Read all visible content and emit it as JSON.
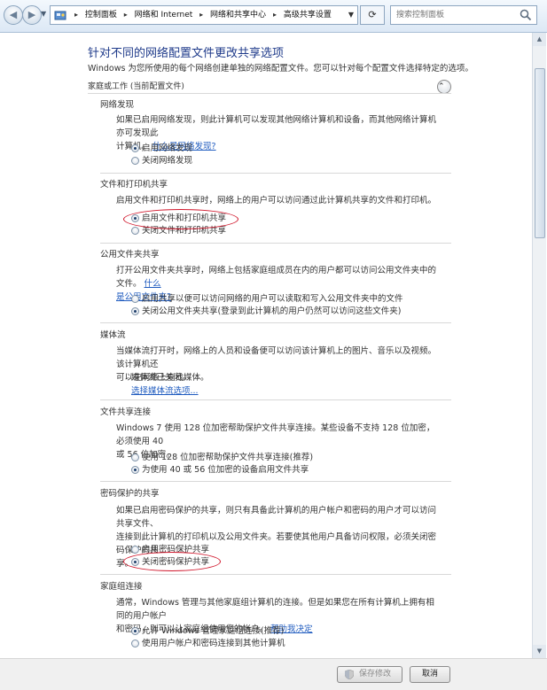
{
  "address_bar": {
    "breadcrumbs": [
      "控制面板",
      "网络和 Internet",
      "网络和共享中心",
      "高级共享设置"
    ],
    "refresh_icon": "refresh-icon"
  },
  "search": {
    "placeholder": "搜索控制面板"
  },
  "page": {
    "title": "针对不同的网络配置文件更改共享选项",
    "subtitle": "Windows 为您所使用的每个网络创建单独的网络配置文件。您可以针对每个配置文件选择特定的选项。",
    "profile_label": "家庭或工作 (当前配置文件)"
  },
  "sections": {
    "network_discovery": {
      "title": "网络发现",
      "desc_line1": "如果已启用网络发现，则此计算机可以发现其他网络计算机和设备，而其他网络计算机亦可发现此",
      "desc_line2": "计算机。",
      "link": "什么是网络发现?",
      "options": [
        "启用网络发现",
        "关闭网络发现"
      ],
      "selected": 0
    },
    "file_printer": {
      "title": "文件和打印机共享",
      "desc": "启用文件和打印机共享时，网络上的用户可以访问通过此计算机共享的文件和打印机。",
      "options": [
        "启用文件和打印机共享",
        "关闭文件和打印机共享"
      ],
      "selected": 0
    },
    "public_folder": {
      "title": "公用文件夹共享",
      "desc_line1": "打开公用文件夹共享时，网络上包括家庭组成员在内的用户都可以访问公用文件夹中的文件。",
      "link_part1": "什么",
      "link_part2": "是公用文件夹?",
      "options": [
        "启用共享以便可以访问网络的用户可以读取和写入公用文件夹中的文件",
        "关闭公用文件夹共享(登录到此计算机的用户仍然可以访问这些文件夹)"
      ],
      "selected": 1
    },
    "media": {
      "title": "媒体流",
      "desc_line1": "当媒体流打开时，网络上的人员和设备便可以访问该计算机上的图片、音乐以及视频。该计算机还",
      "desc_line2": "可以在网络上查找媒体。",
      "status": "媒体流已关闭。",
      "link": "选择媒体流选项..."
    },
    "file_sharing_connection": {
      "title": "文件共享连接",
      "desc_line1": "Windows 7 使用 128 位加密帮助保护文件共享连接。某些设备不支持 128 位加密，必须使用 40",
      "desc_line2": "或 56 位加密。",
      "options": [
        "使用 128 位加密帮助保护文件共享连接(推荐)",
        "为使用 40 或 56 位加密的设备启用文件共享"
      ],
      "selected": 1
    },
    "password_sharing": {
      "title": "密码保护的共享",
      "desc_line1": "如果已启用密码保护的共享，则只有具备此计算机的用户帐户和密码的用户才可以访问共享文件、",
      "desc_line2": "连接到此计算机的打印机以及公用文件夹。若要使其他用户具备访问权限，必须关闭密码保护的共",
      "desc_line3": "享。",
      "options": [
        "启用密码保护共享",
        "关闭密码保护共享"
      ],
      "selected": 1
    },
    "homegroup": {
      "title": "家庭组连接",
      "desc_line1": "通常，Windows 管理与其他家庭组计算机的连接。但是如果您在所有计算机上拥有相同的用户帐户",
      "desc_line2": "和密码，则可以让家庭组使用您的帐户。",
      "link": "帮助我决定",
      "options": [
        "允许 Windows 管理家庭组连接(推荐)",
        "使用用户帐户和密码连接到其他计算机"
      ],
      "selected": 0
    }
  },
  "buttons": {
    "save": "保存修改",
    "cancel": "取消"
  },
  "colors": {
    "title": "#1e3a8a",
    "link": "#1f5bbf",
    "annotation": "#d0162b"
  }
}
